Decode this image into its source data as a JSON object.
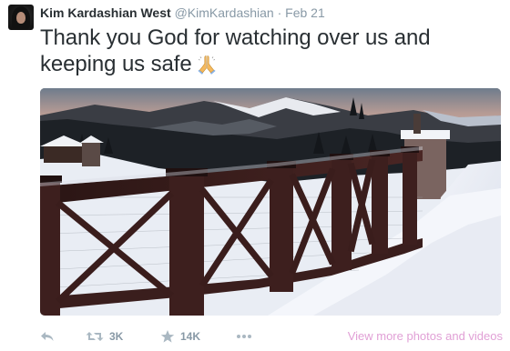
{
  "author": {
    "name": "Kim Kardashian West",
    "handle": "@KimKardashian",
    "separator": "·",
    "time": "Feb 21"
  },
  "tweet": {
    "text": "Thank you God for watching over us and keeping us safe",
    "emoji_icon": "folded-hands-icon"
  },
  "media": {
    "subject": "snowy mountain landscape photo with dark wooden fence"
  },
  "actions": {
    "reply_icon": "reply-icon",
    "retweet_icon": "retweet-icon",
    "retweet_count": "3K",
    "favorite_icon": "star-icon",
    "favorite_count": "14K",
    "more_icon": "more-dots-icon",
    "view_more_label": "View more photos and videos"
  },
  "colors": {
    "text": "#292f33",
    "muted": "#8899a6",
    "view_more": "#e1a0d6"
  }
}
